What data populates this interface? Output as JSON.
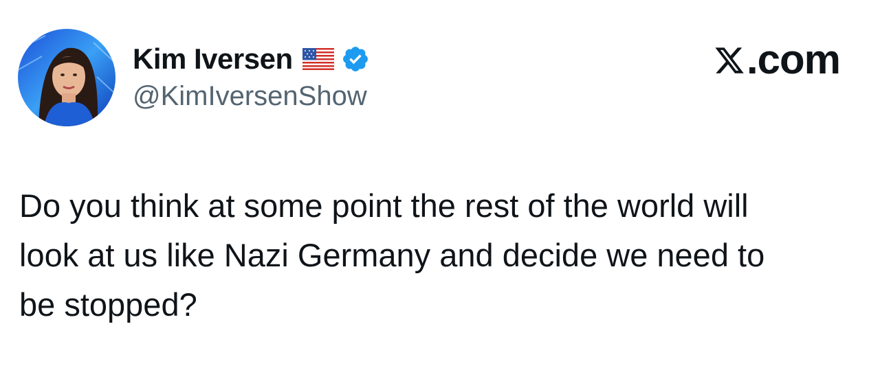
{
  "tweet": {
    "author": {
      "display_name": "Kim Iversen",
      "handle": "@KimIversenShow",
      "avatar": "profile-photo",
      "flag_icon": "us-flag-icon",
      "verified_icon": "verified-badge-icon",
      "verified_color": "#1d9bf0"
    },
    "brand": {
      "label": ".com",
      "logo_icon": "x-logo-icon"
    },
    "text": "Do you think at some point the rest of the world will\nlook at us like Nazi Germany and decide we need to\nbe stopped?"
  }
}
